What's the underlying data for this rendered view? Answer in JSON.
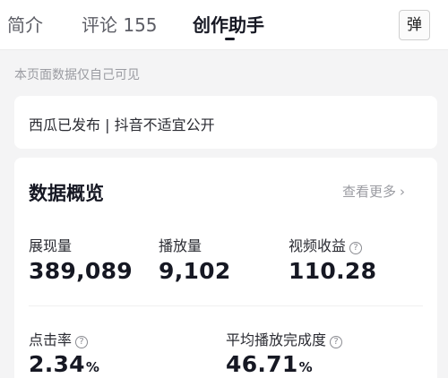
{
  "tabs": [
    {
      "label": "简介"
    },
    {
      "label": "评论 155"
    },
    {
      "label": "创作助手"
    }
  ],
  "danmu_button": {
    "label": "弹"
  },
  "notice": "本页面数据仅自己可见",
  "status": "西瓜已发布 | 抖音不适宜公开",
  "overview": {
    "title": "数据概览",
    "more_link": "查看更多",
    "metrics": [
      {
        "label": "展现量",
        "value": "389,089",
        "unit": ""
      },
      {
        "label": "播放量",
        "value": "9,102",
        "unit": ""
      },
      {
        "label": "视频收益",
        "value": "110.28",
        "unit": ""
      },
      {
        "label": "点击率",
        "value": "2.34",
        "unit": "%"
      },
      {
        "label": "平均播放完成度",
        "value": "46.71",
        "unit": "%"
      }
    ]
  },
  "icons": {
    "help": "question-circle-icon",
    "chevron": "chevron-right-icon"
  },
  "colors": {
    "page_background": "#f4f4f5",
    "card_background": "#ffffff",
    "primary_text": "#161823",
    "secondary_text": "#9a9ba1"
  }
}
